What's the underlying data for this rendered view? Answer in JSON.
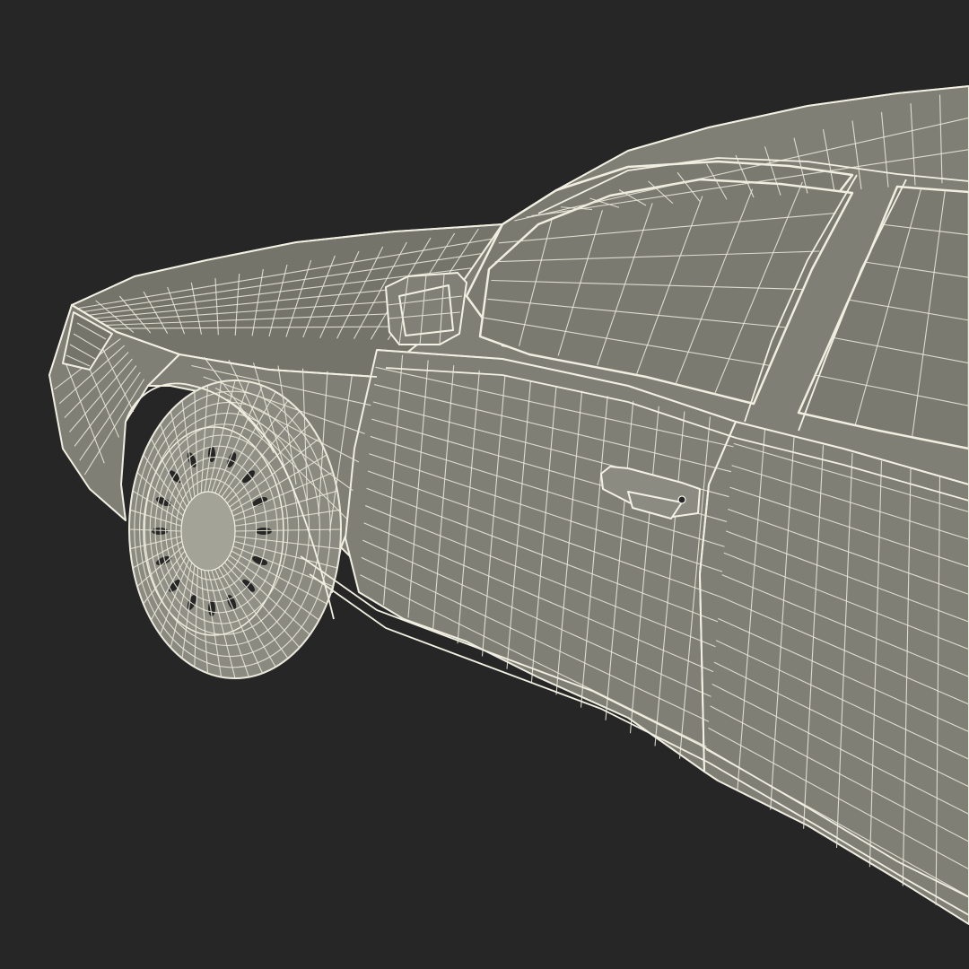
{
  "scene": {
    "subject_icon": "wireframe-sedan-icon",
    "colors": {
      "background": "#262626",
      "body_shade": "#7f7f76",
      "wire": "#efeee0"
    }
  }
}
